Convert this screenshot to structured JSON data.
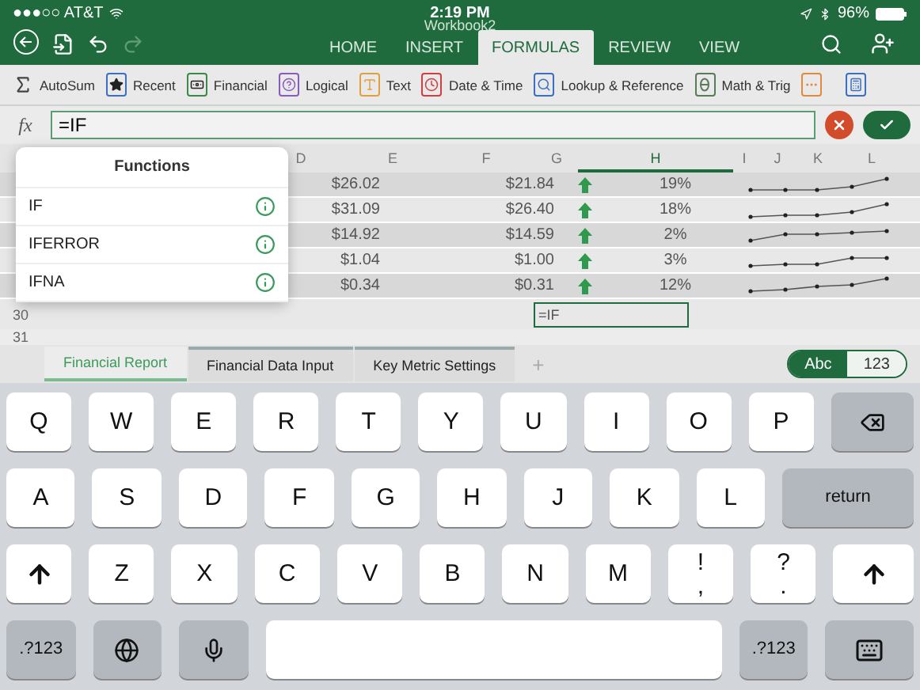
{
  "status_bar": {
    "carrier": "●●●○○ AT&T",
    "time": "2:19 PM",
    "battery": "96%"
  },
  "window": {
    "title": "Workbook2"
  },
  "toolbar": {
    "redo_disabled": true
  },
  "tabs": [
    {
      "label": "HOME",
      "selected": false
    },
    {
      "label": "INSERT",
      "selected": false
    },
    {
      "label": "FORMULAS",
      "selected": true
    },
    {
      "label": "REVIEW",
      "selected": false
    },
    {
      "label": "VIEW",
      "selected": false
    }
  ],
  "ribbon": [
    {
      "label": "AutoSum",
      "kind": "sum"
    },
    {
      "label": "Recent",
      "kind": "star",
      "color": "#3a6fc4"
    },
    {
      "label": "Financial",
      "kind": "money",
      "color": "#3c8a4a"
    },
    {
      "label": "Logical",
      "kind": "question",
      "color": "#8a5bbf"
    },
    {
      "label": "Text",
      "kind": "letter",
      "color": "#e0a040"
    },
    {
      "label": "Date & Time",
      "kind": "clock",
      "color": "#d04040"
    },
    {
      "label": "Lookup & Reference",
      "kind": "search",
      "color": "#3a6fc4"
    },
    {
      "label": "Math & Trig",
      "kind": "theta",
      "color": "#5a7a5a"
    },
    {
      "kind": "more",
      "color": "#e08a40"
    },
    {
      "kind": "calculator",
      "color": "#3a6fc4"
    }
  ],
  "formula_bar": {
    "label": "fx",
    "value": "=IF"
  },
  "columns": [
    {
      "label": "D",
      "selected": false
    },
    {
      "label": "E",
      "selected": false
    },
    {
      "label": "F",
      "selected": false
    },
    {
      "label": "G",
      "selected": false
    },
    {
      "label": "H",
      "selected": true
    },
    {
      "label": "I",
      "selected": false
    },
    {
      "label": "J",
      "selected": false
    },
    {
      "label": "K",
      "selected": false
    },
    {
      "label": "L",
      "selected": false
    }
  ],
  "rows": [
    {
      "col_1": "$26.02",
      "col_2": "$21.84",
      "change": "19%"
    },
    {
      "col_1": "$31.09",
      "col_2": "$26.40",
      "change": "18%"
    },
    {
      "col_1": "$14.92",
      "col_2": "$14.59",
      "change": "2%"
    },
    {
      "col_1": "$1.04",
      "col_2": "$1.00",
      "change": "3%"
    },
    {
      "col_1": "$0.34",
      "col_2": "$0.31",
      "change": "12%"
    }
  ],
  "row_numbers": [
    "30",
    "31"
  ],
  "active_cell": "=IF",
  "autocomplete": {
    "title": "Functions",
    "items": [
      "IF",
      "IFERROR",
      "IFNA"
    ]
  },
  "sheet_tabs": [
    {
      "label": "Financial Report",
      "selected": true
    },
    {
      "label": "Financial Data Input",
      "selected": false
    },
    {
      "label": "Key Metric Settings",
      "selected": false
    }
  ],
  "add_sheet": "+",
  "keyboard_mode": [
    {
      "label": "Abc",
      "selected": true
    },
    {
      "label": "123",
      "selected": false
    }
  ],
  "keyboard": [
    [
      {
        "kind": "char",
        "label": "Q"
      },
      {
        "kind": "char",
        "label": "W"
      },
      {
        "kind": "char",
        "label": "E"
      },
      {
        "kind": "char",
        "label": "R"
      },
      {
        "kind": "char",
        "label": "T"
      },
      {
        "kind": "char",
        "label": "Y"
      },
      {
        "kind": "char",
        "label": "U"
      },
      {
        "kind": "char",
        "label": "I"
      },
      {
        "kind": "char",
        "label": "O"
      },
      {
        "kind": "char",
        "label": "P"
      },
      {
        "kind": "backspace"
      }
    ],
    [
      {
        "kind": "char",
        "label": "A"
      },
      {
        "kind": "char",
        "label": "S"
      },
      {
        "kind": "char",
        "label": "D"
      },
      {
        "kind": "char",
        "label": "F"
      },
      {
        "kind": "char",
        "label": "G"
      },
      {
        "kind": "char",
        "label": "H"
      },
      {
        "kind": "char",
        "label": "J"
      },
      {
        "kind": "char",
        "label": "K"
      },
      {
        "kind": "char",
        "label": "L"
      },
      {
        "kind": "wide",
        "label": "return"
      }
    ],
    [
      {
        "kind": "shift"
      },
      {
        "kind": "char",
        "label": "Z"
      },
      {
        "kind": "char",
        "label": "X"
      },
      {
        "kind": "char",
        "label": "C"
      },
      {
        "kind": "char",
        "label": "V"
      },
      {
        "kind": "char",
        "label": "B"
      },
      {
        "kind": "char",
        "label": "N"
      },
      {
        "kind": "char",
        "label": "M"
      },
      {
        "kind": "dual",
        "label": "!",
        "sub": ","
      },
      {
        "kind": "dual",
        "label": "?",
        "sub": "."
      },
      {
        "kind": "shift"
      }
    ],
    [
      {
        "kind": "mode",
        "label": ".?123"
      },
      {
        "kind": "globe"
      },
      {
        "kind": "mic"
      },
      {
        "kind": "space"
      },
      {
        "kind": "mode",
        "label": ".?123"
      },
      {
        "kind": "hide"
      }
    ]
  ]
}
